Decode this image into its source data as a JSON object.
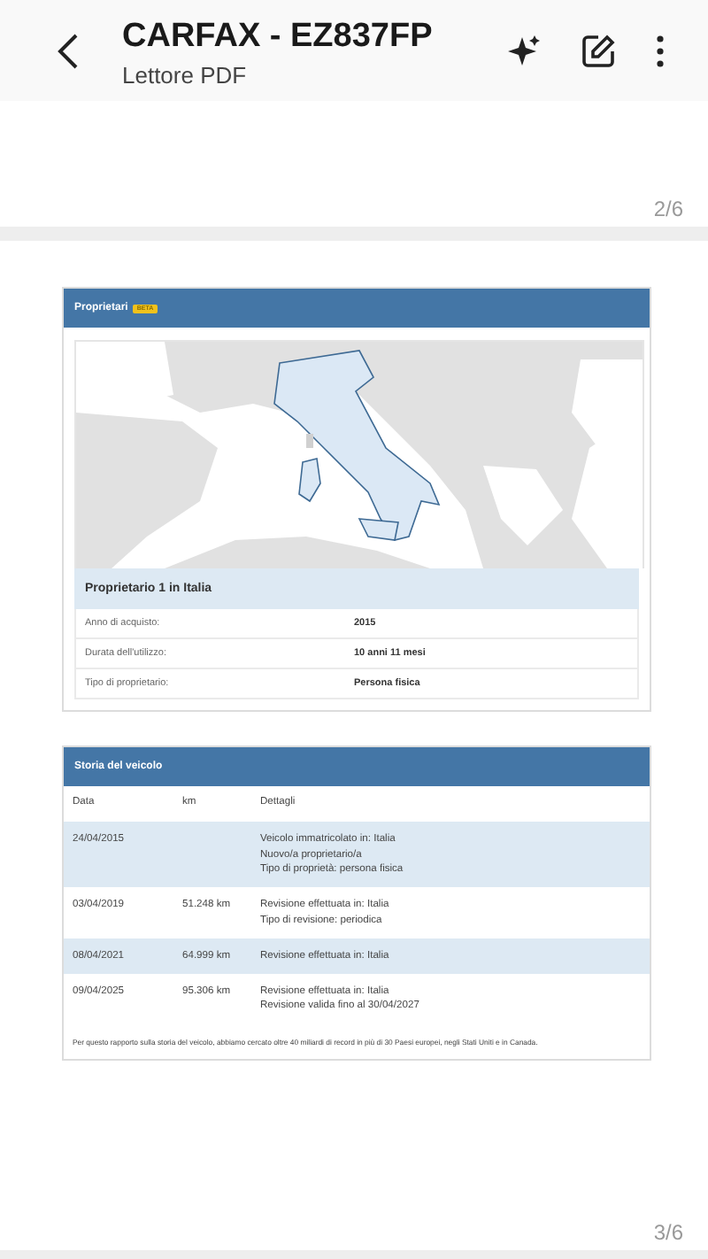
{
  "app_bar": {
    "title": "CARFAX - EZ837FP",
    "subtitle": "Lettore PDF"
  },
  "page_indicators": [
    "2/6",
    "3/6"
  ],
  "owners": {
    "title": "Proprietari",
    "badge": "BETA",
    "owner_title": "Proprietario 1 in Italia",
    "rows": [
      {
        "label": "Anno di acquisto:",
        "value": "2015"
      },
      {
        "label": "Durata dell'utilizzo:",
        "value": "10 anni 11 mesi"
      },
      {
        "label": "Tipo di proprietario:",
        "value": "Persona fisica"
      }
    ]
  },
  "history": {
    "title": "Storia del veicolo",
    "columns": [
      "Data",
      "km",
      "Dettagli"
    ],
    "rows": [
      {
        "date": "24/04/2015",
        "km": "",
        "details": [
          "Veicolo immatricolato in: Italia",
          "Nuovo/a proprietario/a",
          "Tipo di proprietà: persona fisica"
        ]
      },
      {
        "date": "03/04/2019",
        "km": "51.248 km",
        "details": [
          "Revisione effettuata in: Italia",
          "Tipo di revisione: periodica"
        ]
      },
      {
        "date": "08/04/2021",
        "km": "64.999 km",
        "details": [
          "Revisione effettuata in: Italia"
        ]
      },
      {
        "date": "09/04/2025",
        "km": "95.306 km",
        "details": [
          "Revisione effettuata in: Italia",
          "Revisione valida fino al 30/04/2027"
        ]
      }
    ],
    "footnote": "Per questo rapporto sulla storia del veicolo, abbiamo cercato oltre 40 miliardi di record in più di 30 Paesi europei, negli Stati Uniti e in Canada."
  }
}
